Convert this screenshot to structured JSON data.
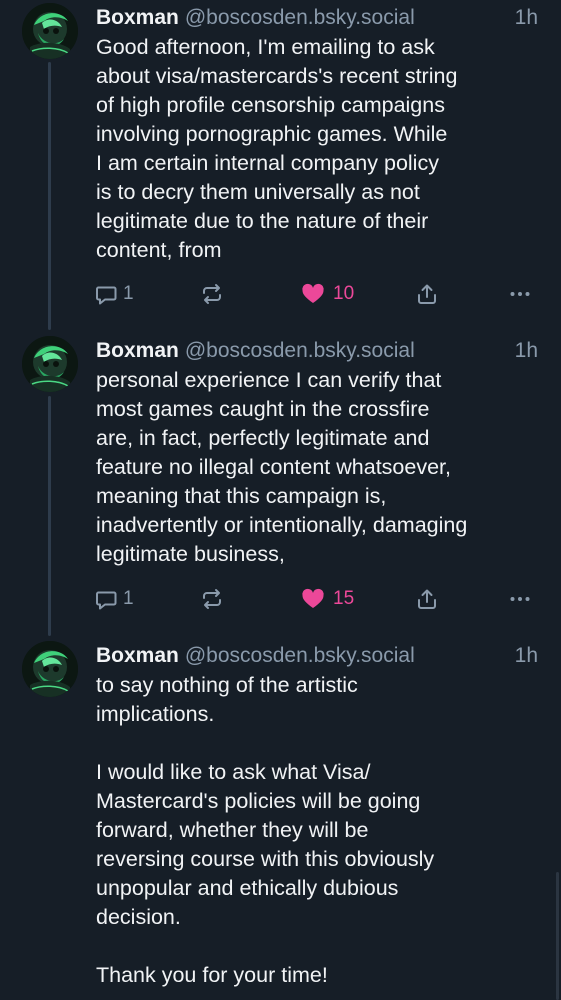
{
  "colors": {
    "background": "#161e27",
    "text": "#f1f3f5",
    "muted": "#8a9aab",
    "like": "#ec4899",
    "thread_line": "#2e3c4c"
  },
  "posts": [
    {
      "author": "Boxman",
      "handle": "@boscosden.bsky.social",
      "time": "1h",
      "lines": [
        "Good afternoon, I'm emailing to ask",
        "about visa/mastercards's recent string",
        "of high profile censorship campaigns",
        "involving pornographic games. While",
        "I am certain internal company policy",
        "is to decry them universally as not",
        "legitimate due to the nature of  their",
        "content, from"
      ],
      "reply_count": "1",
      "like_count": "10",
      "icons": [
        "reply-icon",
        "repost-icon",
        "heart-icon",
        "share-icon",
        "more-icon"
      ]
    },
    {
      "author": "Boxman",
      "handle": "@boscosden.bsky.social",
      "time": "1h",
      "lines": [
        "personal experience I can verify that",
        "most games  caught in the crossfire",
        "are, in fact, perfectly legitimate and",
        "feature  no illegal content whatsoever,",
        "meaning that this campaign is,",
        "inadvertently or intentionally, damaging",
        "legitimate business,"
      ],
      "reply_count": "1",
      "like_count": "15",
      "icons": [
        "reply-icon",
        "repost-icon",
        "heart-icon",
        "share-icon",
        "more-icon"
      ]
    },
    {
      "author": "Boxman",
      "handle": "@boscosden.bsky.social",
      "time": "1h",
      "lines": [
        "to say  nothing of the artistic",
        "implications.",
        "",
        "I would  like to ask what Visa/",
        "Mastercard's policies will be going",
        "forward, whether  they will be",
        "reversing course with this obviously",
        "unpopular and  ethically dubious",
        "decision.",
        "",
        "Thank you for your time!"
      ]
    }
  ]
}
